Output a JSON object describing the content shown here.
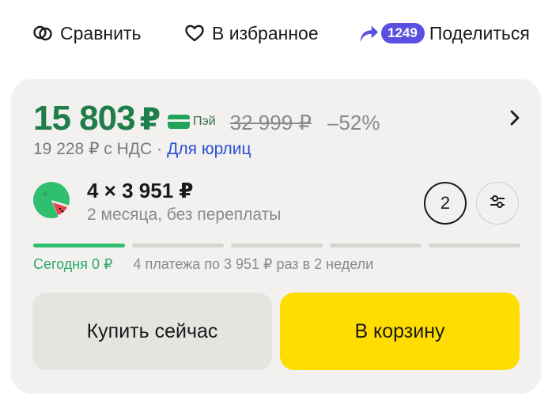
{
  "actions": {
    "compare_label": "Сравнить",
    "favorite_label": "В избранное",
    "share_count": "1249",
    "share_label": "Поделиться"
  },
  "price": {
    "current": "15 803",
    "currency": "₽",
    "pay_label": "Пэй",
    "old": "32 999 ₽",
    "discount": "–52%",
    "vat_text": "19 228 ₽ с НДС",
    "dot": "·",
    "business_link": "Для юрлиц"
  },
  "split": {
    "amount": "4 × 3 951 ₽",
    "subtitle": "2 месяца, без переплаты",
    "count": "2",
    "progress_segments": 5,
    "progress_active": 1,
    "today_text": "Сегодня 0 ₽",
    "schedule_text": "4 платежа по 3 951 ₽ раз в 2 недели"
  },
  "buttons": {
    "buy_now": "Купить сейчас",
    "add_to_cart": "В корзину"
  },
  "colors": {
    "price_green": "#1f7d4a",
    "split_green": "#2fbf6f",
    "link_blue": "#2a4fd6",
    "cart_yellow": "#ffdd00",
    "share_badge": "#5b4fe0"
  },
  "icons": {
    "compare": "compare-icon",
    "favorite": "heart-icon",
    "share": "share-arrow-icon",
    "chevron": "chevron-right-icon",
    "settings": "sliders-icon",
    "split_logo": "split-logo-icon"
  }
}
